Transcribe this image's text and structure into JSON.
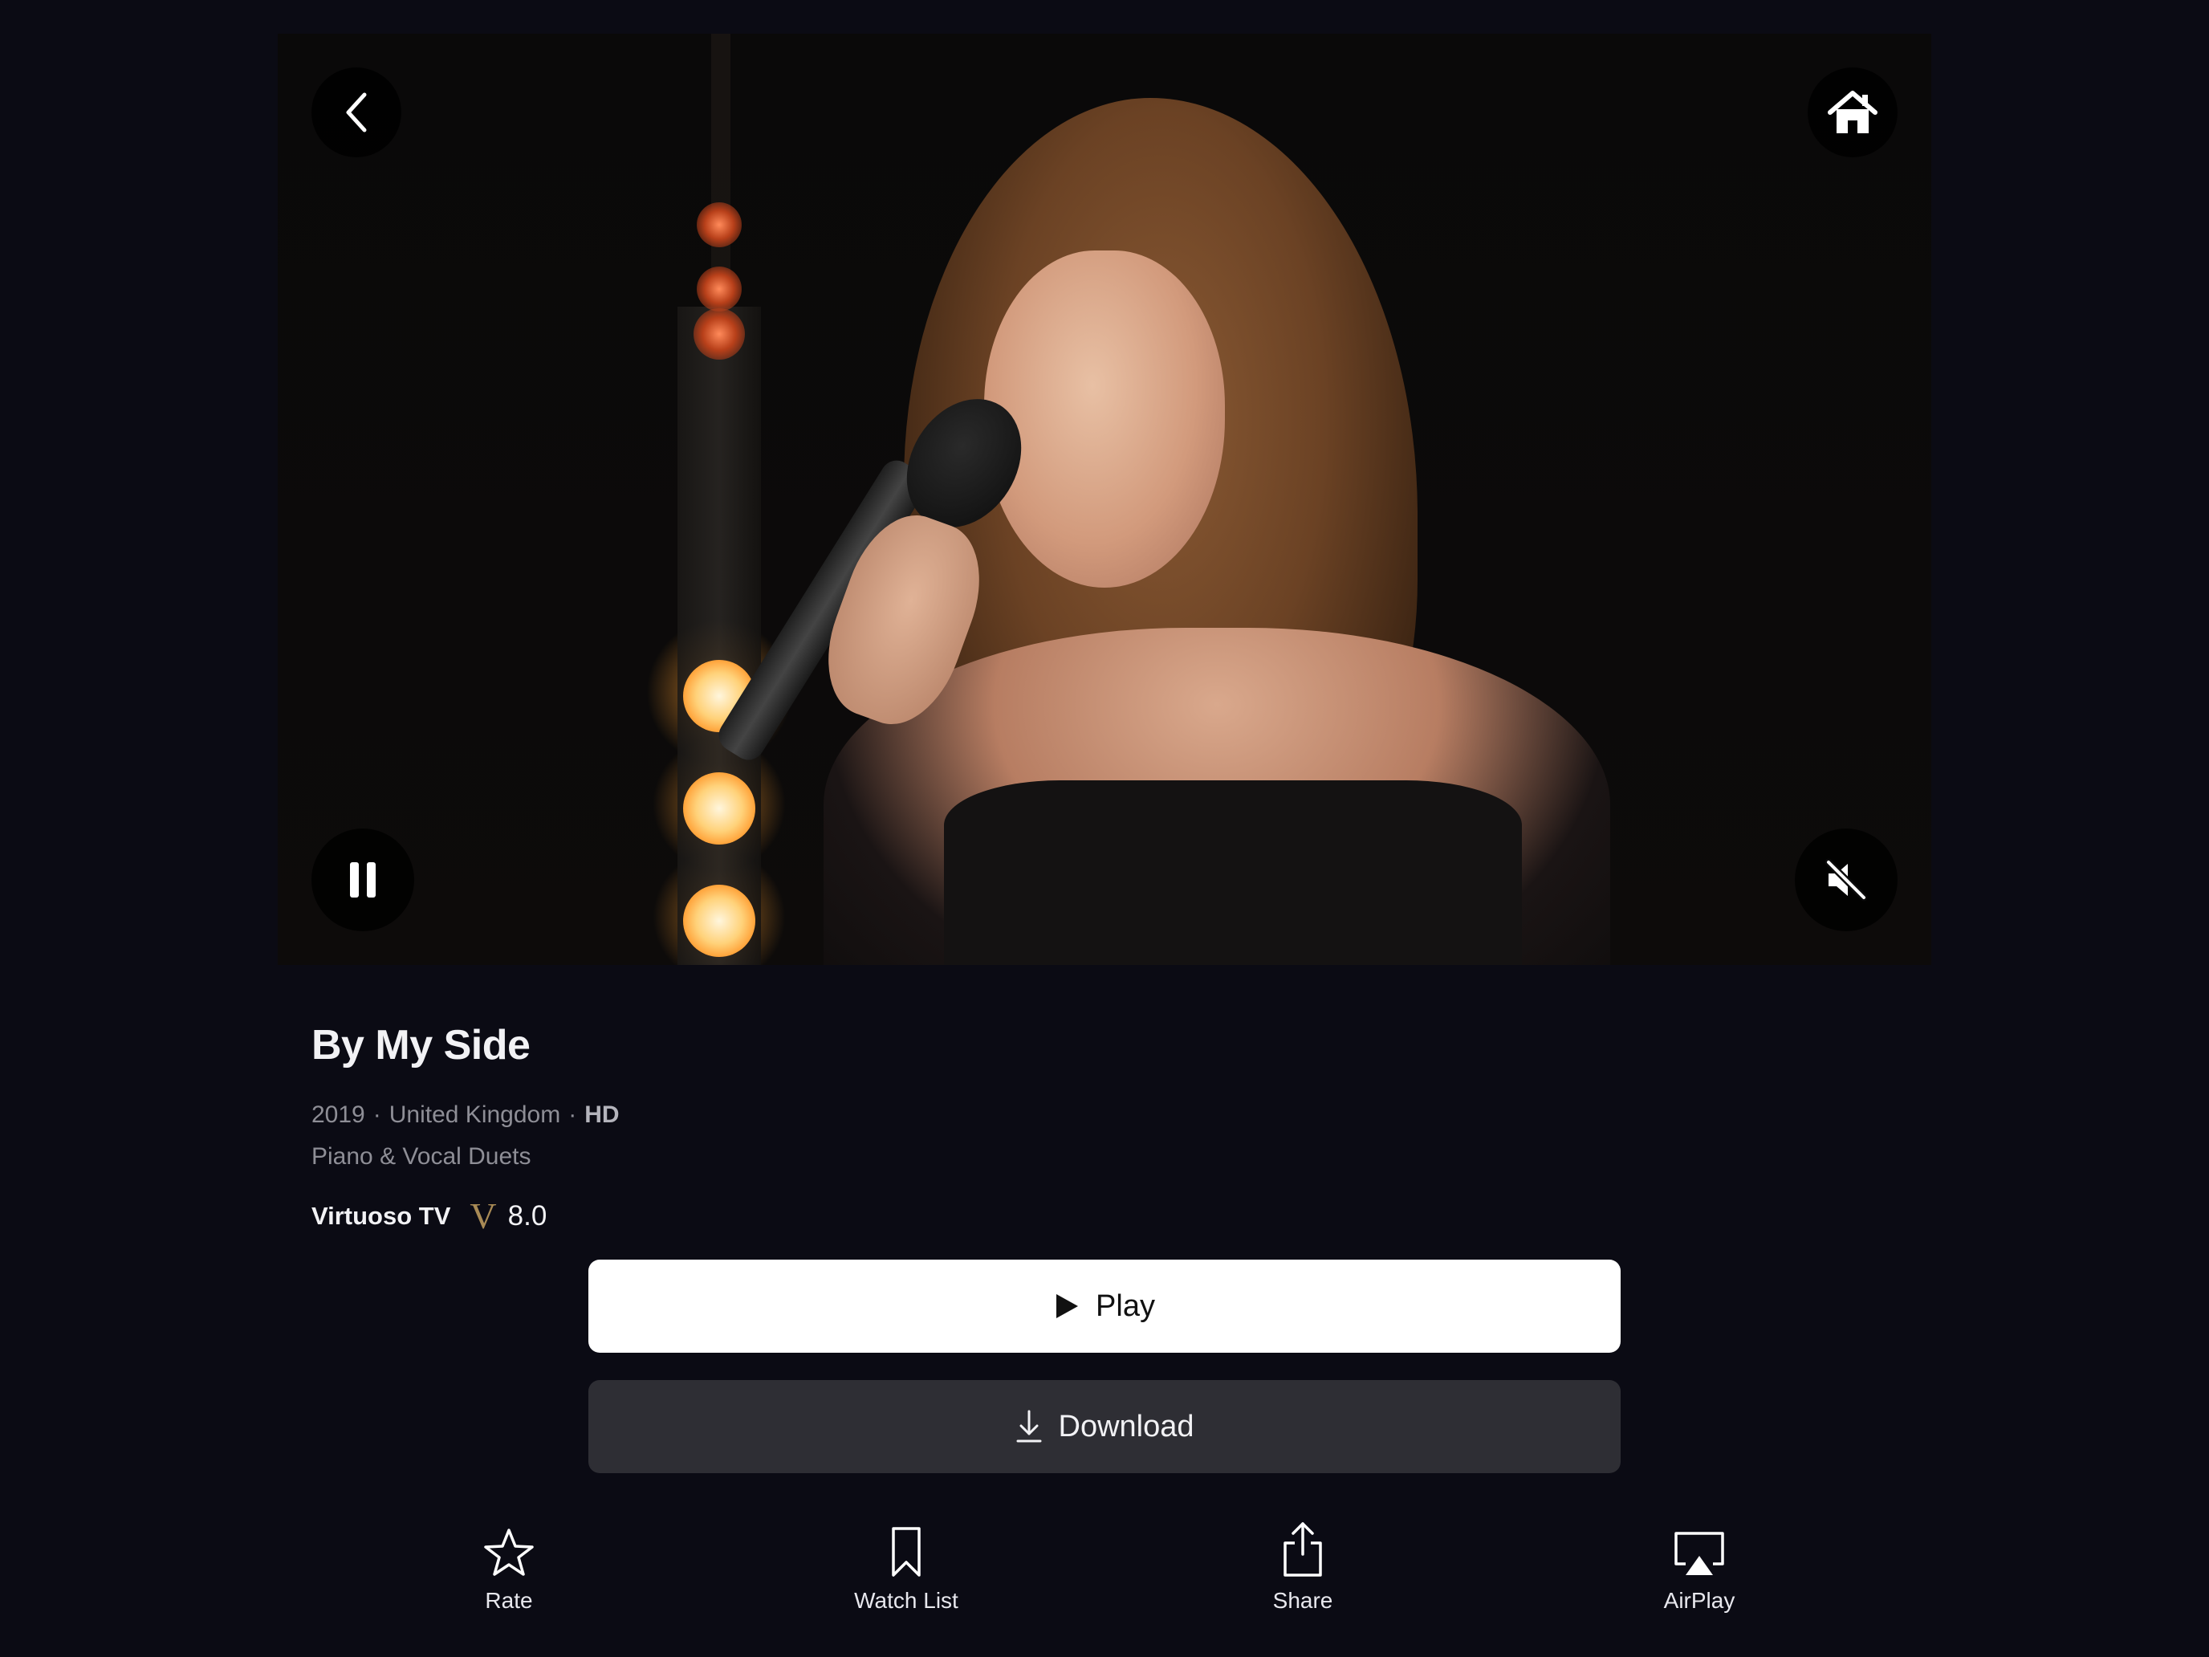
{
  "video": {
    "back_icon": "chevron-left-icon",
    "home_icon": "home-icon",
    "pause_icon": "pause-icon",
    "mute_icon": "speaker-muted-icon"
  },
  "details": {
    "title": "By My Side",
    "year": "2019",
    "country": "United Kingdom",
    "quality": "HD",
    "separator": "·",
    "genre": "Piano & Vocal Duets",
    "rating_source": "Virtuoso TV",
    "rating_logo": "V",
    "rating_score": "8.0"
  },
  "buttons": {
    "play_label": "Play",
    "download_label": "Download"
  },
  "actions": [
    {
      "label": "Rate",
      "icon": "star-icon"
    },
    {
      "label": "Watch List",
      "icon": "bookmark-icon"
    },
    {
      "label": "Share",
      "icon": "share-icon"
    },
    {
      "label": "AirPlay",
      "icon": "airplay-icon"
    }
  ],
  "colors": {
    "background": "#0b0b14",
    "play_button": "#ffffff",
    "download_button": "#2e2e34",
    "rating_logo": "#a88a55"
  }
}
